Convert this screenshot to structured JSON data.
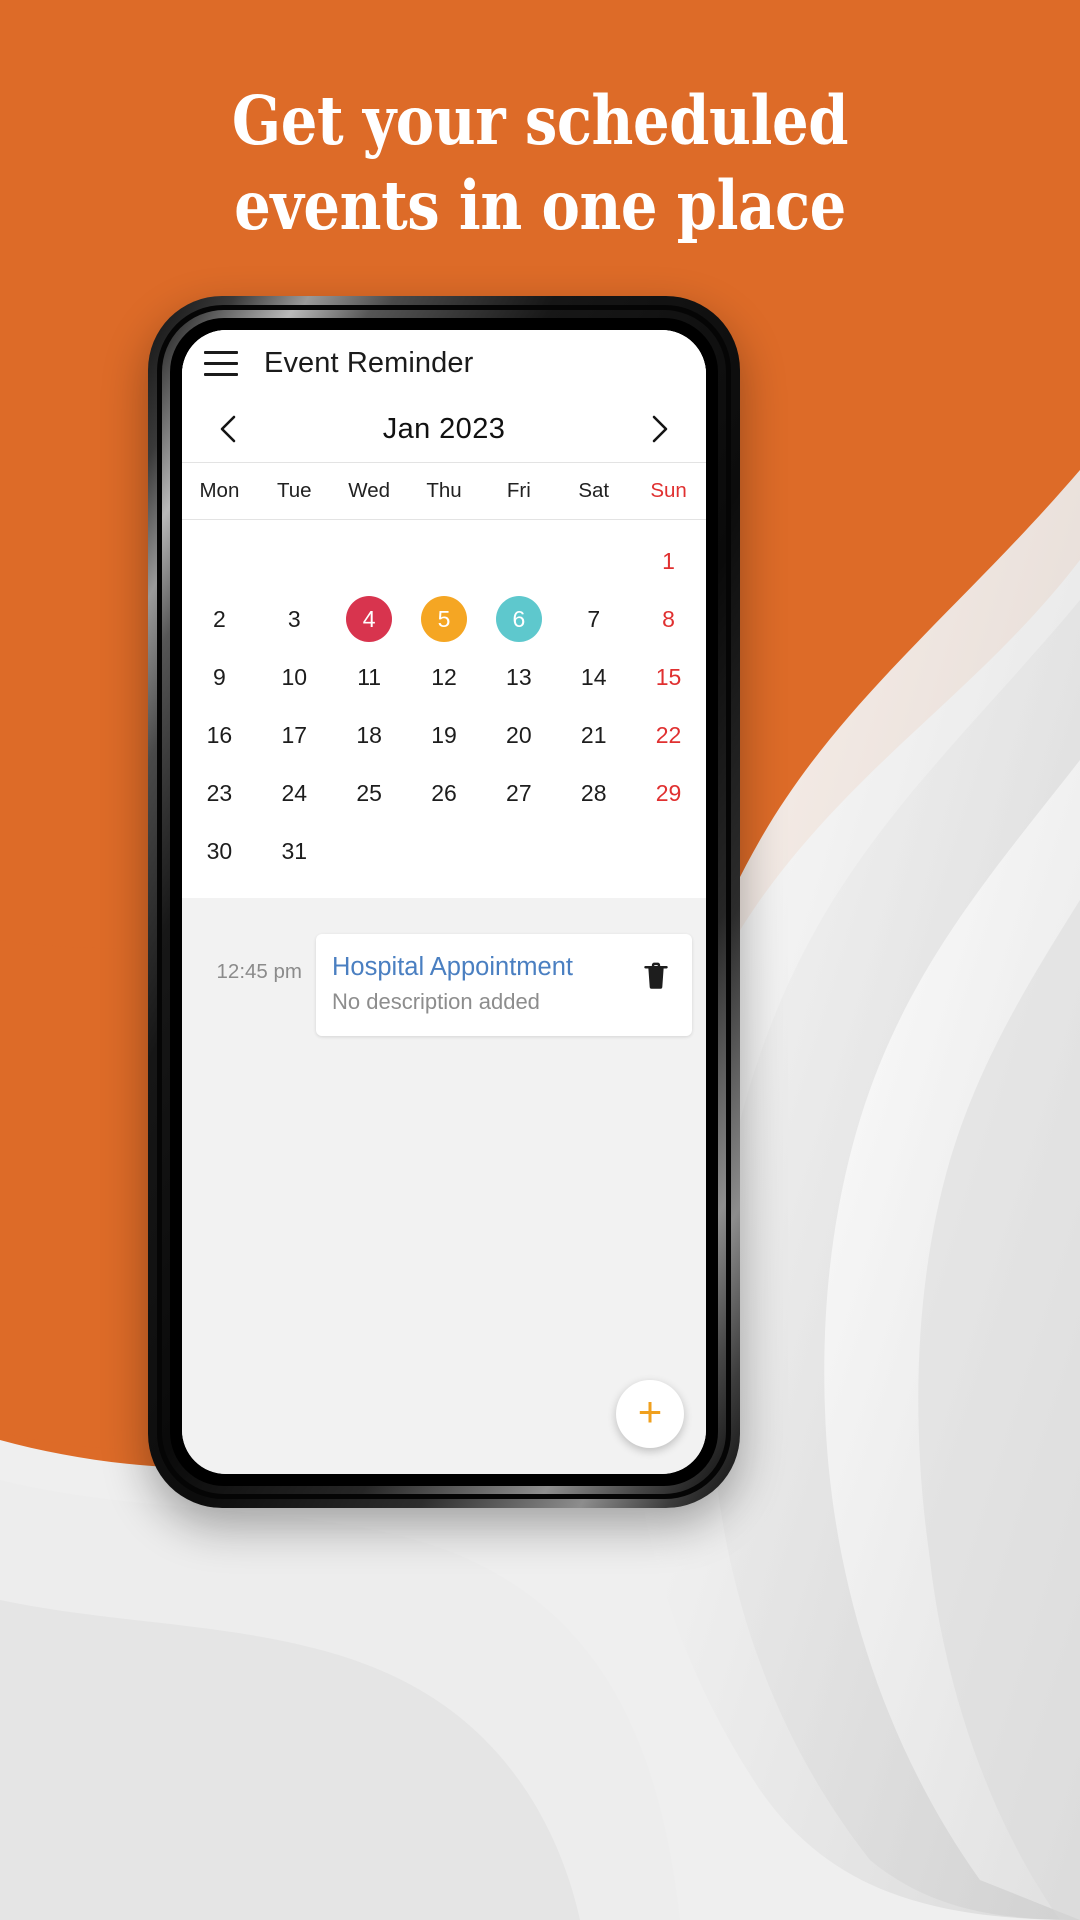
{
  "theme": {
    "orange": "#DD6B28",
    "accent_red": "#e03030",
    "event_title_blue": "#4a7fc1",
    "fab_plus": "#f0a01e"
  },
  "promo": {
    "headline_line1": "Get your scheduled",
    "headline_line2": "events in one place"
  },
  "app": {
    "menu_icon": "hamburger-menu-icon",
    "title": "Event Reminder",
    "month_nav": {
      "prev_icon": "chevron-left-icon",
      "next_icon": "chevron-right-icon",
      "label": "Jan 2023"
    },
    "weekdays": [
      {
        "label": "Mon",
        "weekend": false
      },
      {
        "label": "Tue",
        "weekend": false
      },
      {
        "label": "Wed",
        "weekend": false
      },
      {
        "label": "Thu",
        "weekend": false
      },
      {
        "label": "Fri",
        "weekend": false
      },
      {
        "label": "Sat",
        "weekend": false
      },
      {
        "label": "Sun",
        "weekend": true
      }
    ],
    "days": [
      {
        "label": "",
        "empty": true
      },
      {
        "label": "",
        "empty": true
      },
      {
        "label": "",
        "empty": true
      },
      {
        "label": "",
        "empty": true
      },
      {
        "label": "",
        "empty": true
      },
      {
        "label": "",
        "empty": true
      },
      {
        "label": "1",
        "sunday": true
      },
      {
        "label": "2"
      },
      {
        "label": "3"
      },
      {
        "label": "4",
        "marker_color": "#d8344e"
      },
      {
        "label": "5",
        "marker_color": "#f5a623"
      },
      {
        "label": "6",
        "marker_color": "#5ec8cd"
      },
      {
        "label": "7"
      },
      {
        "label": "8",
        "sunday": true
      },
      {
        "label": "9"
      },
      {
        "label": "10"
      },
      {
        "label": "11"
      },
      {
        "label": "12"
      },
      {
        "label": "13"
      },
      {
        "label": "14"
      },
      {
        "label": "15",
        "sunday": true
      },
      {
        "label": "16"
      },
      {
        "label": "17"
      },
      {
        "label": "18"
      },
      {
        "label": "19"
      },
      {
        "label": "20"
      },
      {
        "label": "21"
      },
      {
        "label": "22",
        "sunday": true
      },
      {
        "label": "23"
      },
      {
        "label": "24"
      },
      {
        "label": "25"
      },
      {
        "label": "26"
      },
      {
        "label": "27"
      },
      {
        "label": "28"
      },
      {
        "label": "29",
        "sunday": true
      },
      {
        "label": "30"
      },
      {
        "label": "31"
      },
      {
        "label": "",
        "empty": true
      },
      {
        "label": "",
        "empty": true
      },
      {
        "label": "",
        "empty": true
      },
      {
        "label": "",
        "empty": true
      },
      {
        "label": "",
        "empty": true
      }
    ],
    "events": [
      {
        "time": "12:45 pm",
        "title": "Hospital Appointment",
        "description": "No description added",
        "delete_icon": "trash-icon"
      }
    ],
    "fab": {
      "icon": "plus-icon",
      "label": "+"
    }
  }
}
